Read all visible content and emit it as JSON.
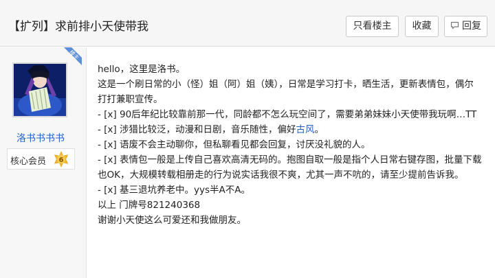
{
  "header": {
    "title": "【扩列】求前排小天使带我",
    "only_owner_label": "只看楼主",
    "favorite_label": "收藏",
    "reply_label": "回复"
  },
  "author": {
    "badge": "楼主",
    "name": "洛书书书书",
    "member_title": "核心会员",
    "level": "6"
  },
  "post": {
    "greeting": "hello，这里是洛书。",
    "intro": "这是一个刷日常的小（怪）姐（阿）姐（姨），日常是学习打卡，晒生活，更新表情包，偶尔打打兼职宣传。",
    "item1": "- [x] 90后年纪比较靠前那一代，同龄都不怎么玩空间了，需要弟弟妹妹小天使带我玩啊…TT",
    "item2_prefix": "- [x] 涉猎比较泛，动漫和日剧，音乐随性，偏好",
    "item2_link": "古风",
    "item2_suffix": "。",
    "item3": "- [x] 语废不会主动聊你，但私聊看见都会回复，讨厌没礼貌的人。",
    "item4": "- [x] 表情包一般是上传自己喜欢高清无码的。抱图自取一般是指个人日常右键存图，批量下载也OK，大规模转载相册走的行为说实话我很不爽，尤其一声不吭的，请至少提前告诉我。",
    "item5": "- [x] 基三退坑养老中。yys半A不A。",
    "house_number": "以上 门牌号821240368",
    "thanks": "谢谢小天使这么可爱还和我做朋友。"
  },
  "colors": {
    "link": "#1f5fc6",
    "badge": "#5b8fd8",
    "level_badge": "#f2b72c"
  }
}
